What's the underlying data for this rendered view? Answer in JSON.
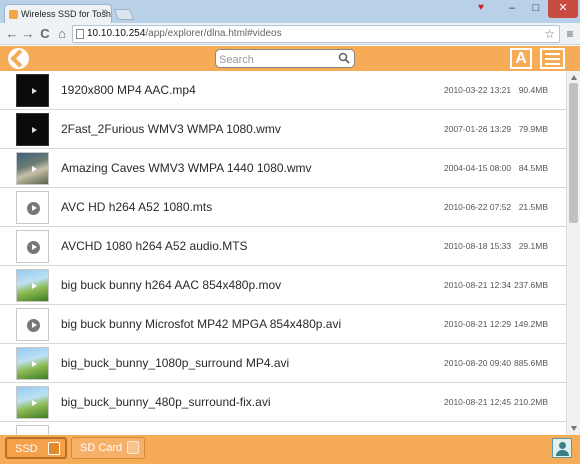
{
  "browser": {
    "tab_title": "Wireless SSD for Toshiba",
    "tab_close": "×",
    "url_host": "10.10.10.254",
    "url_path": "/app/explorer/dlna.html#videos",
    "back_glyph": "←",
    "forward_glyph": "→",
    "reload_glyph": "C",
    "home_glyph": "⌂",
    "star_glyph": "☆",
    "menu_glyph": "≡",
    "minimize_glyph": "–",
    "maximize_glyph": "□",
    "close_glyph": "✕"
  },
  "header": {
    "search_placeholder": "Search",
    "font_button_label": "A"
  },
  "files": [
    {
      "name": "1920x800 MP4 AAC.mp4",
      "date": "2010-03-22 13:21",
      "size": "90.4MB",
      "thumb": "dark"
    },
    {
      "name": "2Fast_2Furious WMV3 WMPA 1080.wmv",
      "date": "2007-01-26 13:29",
      "size": "79.9MB",
      "thumb": "dark"
    },
    {
      "name": "Amazing Caves WMV3 WMPA 1440 1080.wmv",
      "date": "2004-04-15 08:00",
      "size": "84.5MB",
      "thumb": "cave"
    },
    {
      "name": "AVC HD h264 A52 1080.mts",
      "date": "2010-06-22 07:52",
      "size": "21.5MB",
      "thumb": "generic"
    },
    {
      "name": "AVCHD 1080 h264 A52 audio.MTS",
      "date": "2010-08-18 15:33",
      "size": "29.1MB",
      "thumb": "generic"
    },
    {
      "name": "big buck bunny h264 AAC 854x480p.mov",
      "date": "2010-08-21 12:34",
      "size": "237.6MB",
      "thumb": "bunny"
    },
    {
      "name": "big buck bunny Microsfot MP42 MPGA 854x480p.avi",
      "date": "2010-08-21 12:29",
      "size": "149.2MB",
      "thumb": "generic"
    },
    {
      "name": "big_buck_bunny_1080p_surround MP4.avi",
      "date": "2010-08-20 09:40",
      "size": "885.6MB",
      "thumb": "bunny"
    },
    {
      "name": "big_buck_bunny_480p_surround-fix.avi",
      "date": "2010-08-21 12:45",
      "size": "210.2MB",
      "thumb": "bunny"
    },
    {
      "name": "",
      "date": "",
      "size": "",
      "thumb": "generic"
    }
  ],
  "footer": {
    "sources": [
      {
        "label": "SSD",
        "selected": true
      },
      {
        "label": "SD Card",
        "selected": false
      }
    ]
  },
  "colors": {
    "accent": "#f6ab57",
    "text": "#2a2a2a"
  }
}
